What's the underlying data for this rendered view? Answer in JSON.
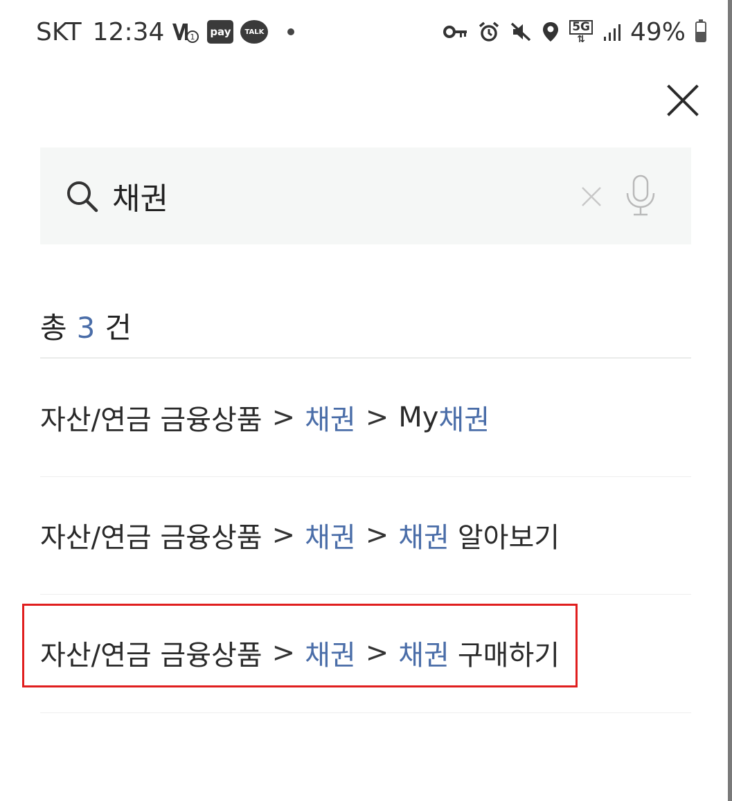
{
  "status_bar": {
    "carrier": "SKT",
    "time": "12:34",
    "pay_badge": "pay",
    "talk_badge": "TALK",
    "network": "5G",
    "battery_percent": "49%",
    "battery_level": 0.49,
    "icons_left": [
      "volte-icon",
      "pay-icon",
      "kakaotalk-icon",
      "dot-icon"
    ],
    "icons_right": [
      "key-icon",
      "alarm-icon",
      "mute-icon",
      "location-icon",
      "5g-icon",
      "signal-icon",
      "battery-icon"
    ]
  },
  "header": {
    "close_icon": "close-icon"
  },
  "search": {
    "query": "채권",
    "search_icon": "search-icon",
    "clear_icon": "clear-icon",
    "mic_icon": "mic-icon"
  },
  "results": {
    "count_prefix": "총",
    "count": "3",
    "count_suffix": "건",
    "items": [
      {
        "category": "자산/연금 금융상품",
        "sep1": ">",
        "level2": "채권",
        "sep2": ">",
        "prefix": "My",
        "keyword": "채권",
        "suffix": ""
      },
      {
        "category": "자산/연금 금융상품",
        "sep1": ">",
        "level2": "채권",
        "sep2": ">",
        "prefix": "",
        "keyword": "채권",
        "suffix": "알아보기"
      },
      {
        "category": "자산/연금 금융상품",
        "sep1": ">",
        "level2": "채권",
        "sep2": ">",
        "prefix": "",
        "keyword": "채권",
        "suffix": "구매하기"
      }
    ]
  },
  "colors": {
    "highlight": "#4a6da8",
    "text": "#222222",
    "search_bg": "#f5f7f6",
    "annotation_box": "#e01e1e"
  }
}
